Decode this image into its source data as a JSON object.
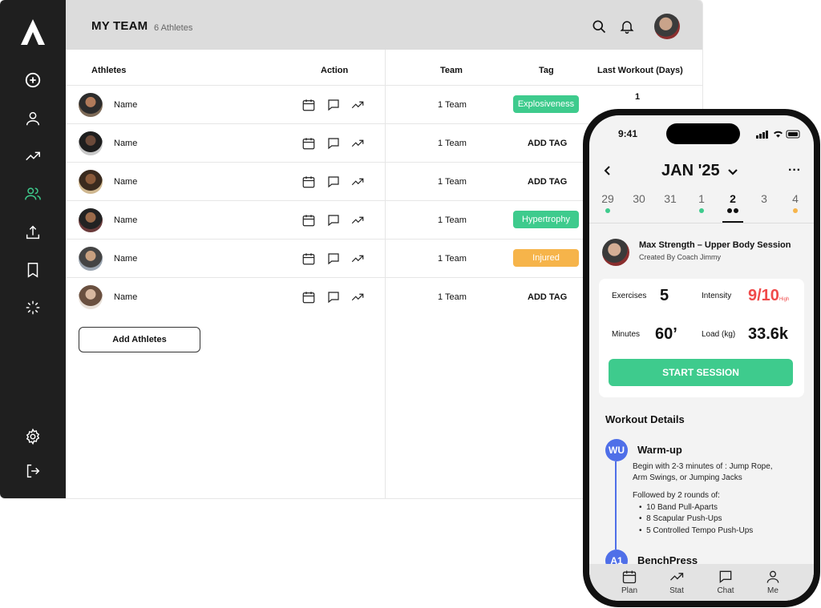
{
  "header": {
    "title": "MY TEAM",
    "count": "6 Athletes"
  },
  "columns": {
    "athletes": "Athletes",
    "action": "Action",
    "team": "Team",
    "tag": "Tag",
    "last_workout": "Last Workout (Days)"
  },
  "rows": [
    {
      "name": "Name",
      "team": "1 Team",
      "tag": "Explosiveness",
      "tag_color": "#3ecb8d",
      "last_workout": "1"
    },
    {
      "name": "Name",
      "team": "1 Team",
      "tag": "ADD TAG"
    },
    {
      "name": "Name",
      "team": "1 Team",
      "tag": "ADD TAG"
    },
    {
      "name": "Name",
      "team": "1 Team",
      "tag": "Hypertrophy",
      "tag_color": "#3ecb8d"
    },
    {
      "name": "Name",
      "team": "1 Team",
      "tag": "Injured",
      "tag_color": "#f6b44a"
    },
    {
      "name": "Name",
      "team": "1 Team",
      "tag": "ADD TAG"
    }
  ],
  "add_athletes_label": "Add Athletes",
  "sidebar_icons": [
    "logo-icon",
    "plus-circle-icon",
    "user-icon",
    "trend-icon",
    "team-icon",
    "upload-icon",
    "bookmark-icon",
    "loader-icon",
    "gear-icon",
    "logout-icon"
  ],
  "phone": {
    "time": "9:41",
    "month": "JAN '25",
    "days": [
      {
        "label": "29",
        "dot": "#3ecb8d"
      },
      {
        "label": "30"
      },
      {
        "label": "31"
      },
      {
        "label": "1",
        "dot": "#3ecb8d"
      },
      {
        "label": "2",
        "selected": true
      },
      {
        "label": "3"
      },
      {
        "label": "4",
        "dot": "#f6b44a"
      }
    ],
    "session": {
      "title": "Max Strength – Upper Body Session",
      "subtitle": "Created By Coach Jimmy"
    },
    "stats": {
      "exercises_label": "Exercises",
      "exercises_value": "5",
      "intensity_label": "Intensity",
      "intensity_value": "9/10",
      "intensity_unit": "High",
      "intensity_color": "#f04a4a",
      "minutes_label": "Minutes",
      "minutes_value": "60’",
      "load_label": "Load (kg)",
      "load_value": "33.6k"
    },
    "start_label": "START SESSION",
    "details_title": "Workout Details",
    "warmup": {
      "badge": "WU",
      "title": "Warm-up",
      "line1": "Begin with 2-3 minutes of : Jump Rope,",
      "line2": "Arm Swings, or Jumping Jacks",
      "rounds": "Followed by 2 rounds of:",
      "items": [
        "10 Band Pull-Aparts",
        "8 Scapular Push-Ups",
        "5 Controlled Tempo Push-Ups"
      ]
    },
    "next": {
      "badge": "A1",
      "title": "BenchPress"
    },
    "tabs": [
      "Plan",
      "Stat",
      "Chat",
      "Me"
    ]
  },
  "colors": {
    "accent": "#3ecb8d",
    "warning": "#f6b44a",
    "blue": "#4f6fe8",
    "sidebar": "#1f1f1f"
  }
}
